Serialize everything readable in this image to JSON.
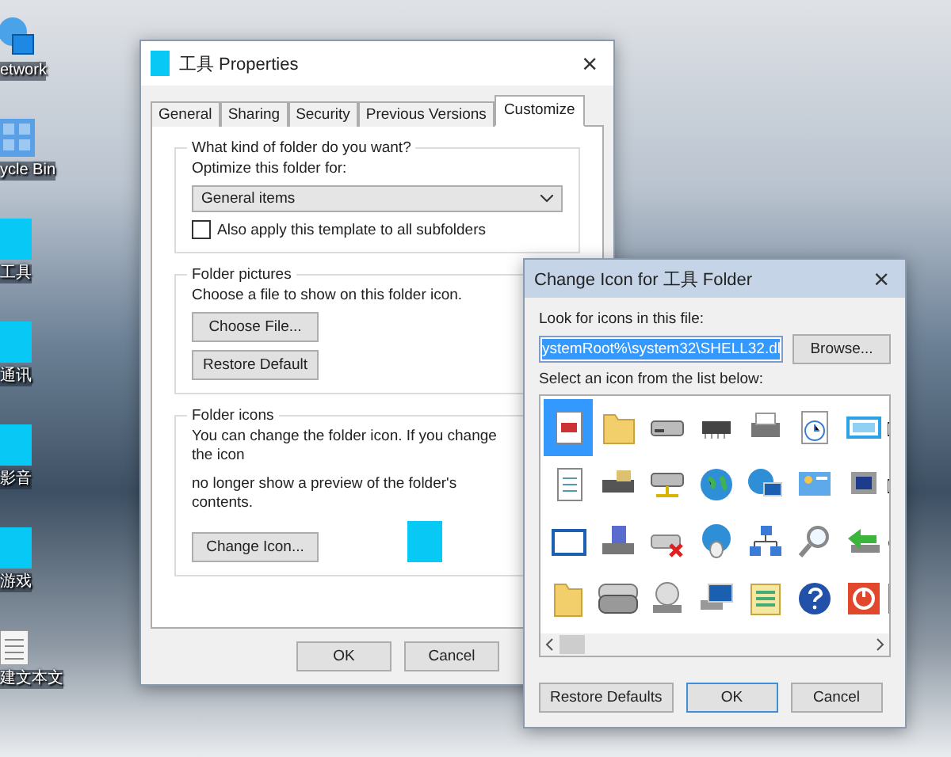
{
  "desktop": {
    "items": [
      {
        "label": "etwork",
        "kind": "network"
      },
      {
        "label": "ycle Bin",
        "kind": "bin"
      },
      {
        "label": "工具",
        "kind": "folder"
      },
      {
        "label": "通讯",
        "kind": "folder"
      },
      {
        "label": "影音",
        "kind": "folder"
      },
      {
        "label": "游戏",
        "kind": "folder"
      },
      {
        "label": "建文本文",
        "kind": "text"
      }
    ]
  },
  "properties": {
    "title": "工具 Properties",
    "close": "×",
    "tabs": [
      {
        "label": "General",
        "selected": false
      },
      {
        "label": "Sharing",
        "selected": false
      },
      {
        "label": "Security",
        "selected": false
      },
      {
        "label": "Previous Versions",
        "selected": false
      },
      {
        "label": "Customize",
        "selected": true
      }
    ],
    "folder_type": {
      "heading": "What kind of folder do you want?",
      "label": "Optimize this folder for:",
      "value": "General items",
      "checkbox": {
        "label": "Also apply this template to all subfolders",
        "checked": false
      }
    },
    "folder_pictures": {
      "heading": "Folder pictures",
      "text": "Choose a file to show on this folder icon.",
      "buttons": [
        "Choose File...",
        "Restore Default"
      ]
    },
    "folder_icons": {
      "heading": "Folder icons",
      "lines": [
        "You can change the folder icon. If you change the icon",
        "no longer show a preview of the folder's contents."
      ],
      "button": "Change Icon..."
    },
    "buttons": [
      "OK",
      "Cancel"
    ]
  },
  "change_icon": {
    "title": "Change Icon for 工具 Folder",
    "close": "×",
    "file_label": "Look for icons in this file:",
    "file_value": "ystemRoot%\\system32\\SHELL32.dl",
    "browse": "Browse...",
    "list_label": "Select an icon from the list below:",
    "icons": [
      {
        "selected": true
      },
      {
        "selected": false
      },
      {
        "selected": false
      },
      {
        "selected": false
      },
      {
        "selected": false
      },
      {
        "selected": false
      },
      {
        "selected": false
      },
      {
        "selected": false
      },
      {
        "selected": false
      },
      {
        "selected": false
      },
      {
        "selected": false
      },
      {
        "selected": false
      },
      {
        "selected": false
      },
      {
        "selected": false
      },
      {
        "selected": false
      },
      {
        "selected": false
      },
      {
        "selected": false
      },
      {
        "selected": false
      },
      {
        "selected": false
      },
      {
        "selected": false
      },
      {
        "selected": false
      },
      {
        "selected": false
      },
      {
        "selected": false
      },
      {
        "selected": false
      },
      {
        "selected": false
      },
      {
        "selected": false
      },
      {
        "selected": false
      },
      {
        "selected": false
      },
      {
        "selected": false
      },
      {
        "selected": false
      },
      {
        "selected": false
      },
      {
        "selected": false
      }
    ],
    "buttons": [
      "Restore Defaults",
      "OK",
      "Cancel"
    ]
  }
}
